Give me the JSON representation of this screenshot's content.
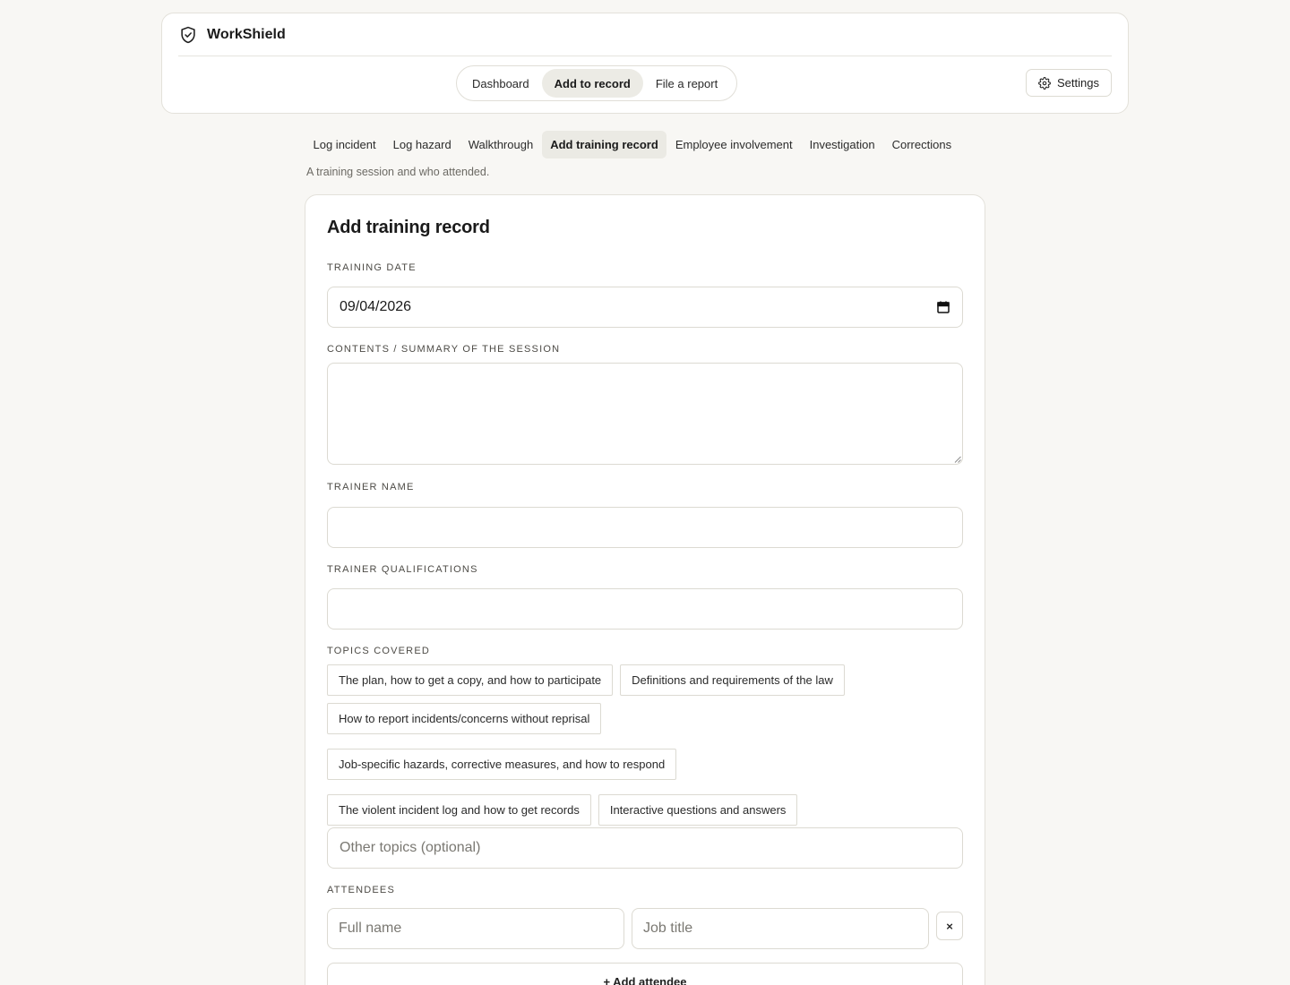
{
  "brand": {
    "name": "WorkShield",
    "icon": "shield-check-icon"
  },
  "main_nav": [
    {
      "label": "Dashboard",
      "active": false
    },
    {
      "label": "Add to record",
      "active": true
    },
    {
      "label": "File a report",
      "active": false
    }
  ],
  "settings": {
    "label": "Settings",
    "icon": "gear-icon"
  },
  "sub_tabs": [
    {
      "label": "Log incident",
      "active": false
    },
    {
      "label": "Log hazard",
      "active": false
    },
    {
      "label": "Walkthrough",
      "active": false
    },
    {
      "label": "Add training record",
      "active": true
    },
    {
      "label": "Employee involvement",
      "active": false
    },
    {
      "label": "Investigation",
      "active": false
    },
    {
      "label": "Corrections",
      "active": false
    }
  ],
  "tab_description": "A training session and who attended.",
  "form": {
    "title": "Add training record",
    "training_date": {
      "label": "Training date",
      "value": "09/04/2026",
      "icon": "calendar-icon"
    },
    "summary": {
      "label": "Contents / summary of the session",
      "value": ""
    },
    "trainer_name": {
      "label": "Trainer name",
      "value": ""
    },
    "trainer_qualifications": {
      "label": "Trainer qualifications",
      "value": ""
    },
    "topics": {
      "label": "Topics covered",
      "options": [
        "The plan, how to get a copy, and how to participate",
        "Definitions and requirements of the law",
        "How to report incidents/concerns without reprisal",
        "Job-specific hazards, corrective measures, and how to respond",
        "The violent incident log and how to get records",
        "Interactive questions and answers"
      ],
      "other_placeholder": "Other topics (optional)"
    },
    "attendees": {
      "label": "Attendees",
      "name_placeholder": "Full name",
      "title_placeholder": "Job title",
      "remove_label": "×",
      "add_label": "+ Add attendee"
    }
  },
  "colors": {
    "background": "#f8f7f4",
    "card": "#ffffff",
    "border": "#e3e1da",
    "active_pill": "#ecebe5"
  }
}
